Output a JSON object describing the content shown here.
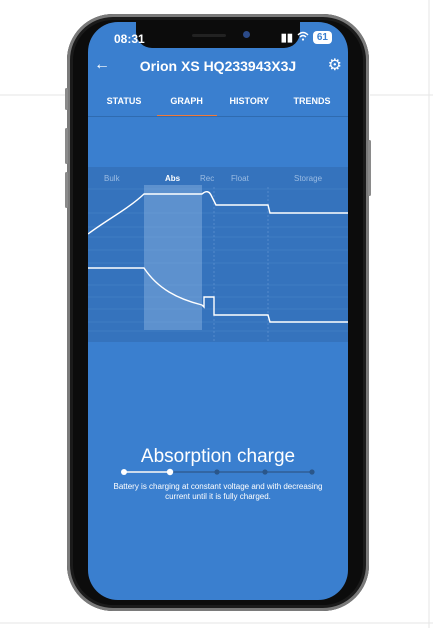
{
  "status_bar": {
    "time": "08:31",
    "battery": "61"
  },
  "header": {
    "title": "Orion XS HQ233943X3J"
  },
  "tabs": [
    {
      "label": "STATUS",
      "active": false
    },
    {
      "label": "GRAPH",
      "active": true
    },
    {
      "label": "HISTORY",
      "active": false
    },
    {
      "label": "TRENDS",
      "active": false
    }
  ],
  "graph": {
    "phases": [
      {
        "label": "Bulk",
        "active": false
      },
      {
        "label": "Abs",
        "active": true
      },
      {
        "label": "Rec",
        "active": false
      },
      {
        "label": "Float",
        "active": false
      },
      {
        "label": "Storage",
        "active": false
      }
    ]
  },
  "description": {
    "title": "Absorption charge",
    "text": "Battery is charging at constant voltage and with decreasing current until it is fully charged."
  },
  "stepper": {
    "steps": 5,
    "current": 2
  },
  "colors": {
    "screen": "#3a7fcf",
    "accent_tab_underline": "#f07a3a"
  }
}
